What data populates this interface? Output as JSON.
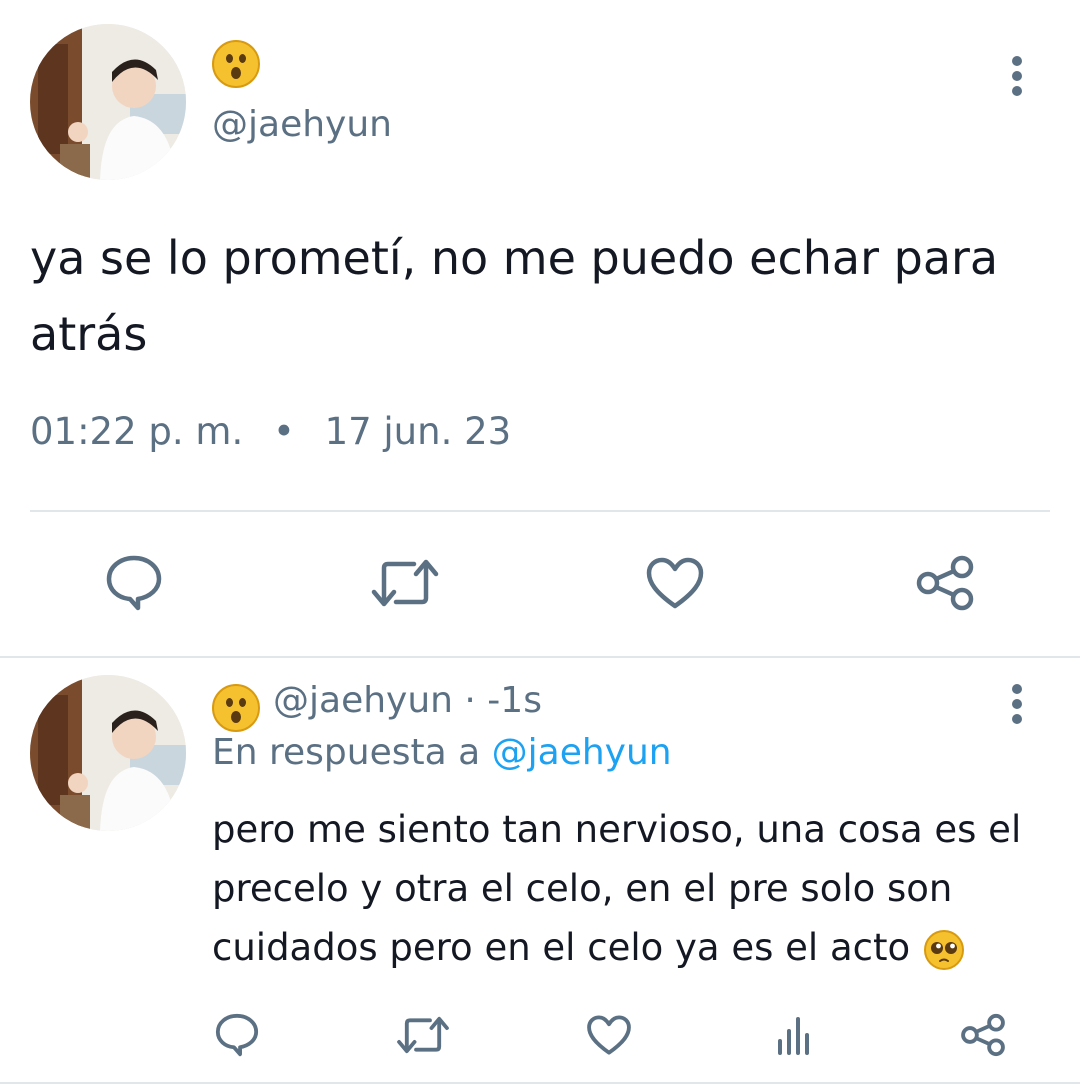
{
  "main_tweet": {
    "handle": "@jaehyun",
    "emoji_name": "hushed-face-emoji",
    "text": "ya se lo prometí, no me puedo echar para atrás",
    "time": "01:22 p. m.",
    "separator": "•",
    "date": "17 jun. 23",
    "actions": [
      "reply",
      "retweet",
      "like",
      "share"
    ]
  },
  "reply_tweet": {
    "handle": "@jaehyun",
    "time_ago": "· -1s",
    "in_reply_prefix": "En respuesta a",
    "in_reply_mention": "@jaehyun",
    "text": "pero me siento tan nervioso, una cosa es el precelo y otra el celo, en el pre solo son cuidados pero en el celo ya es el acto",
    "trailing_emoji": "pleading-face-emoji",
    "actions": [
      "reply",
      "retweet",
      "like",
      "analytics",
      "share"
    ]
  },
  "colors": {
    "secondary_text": "#5b7083",
    "link": "#1da1f2",
    "divider": "#e1e6ea"
  }
}
